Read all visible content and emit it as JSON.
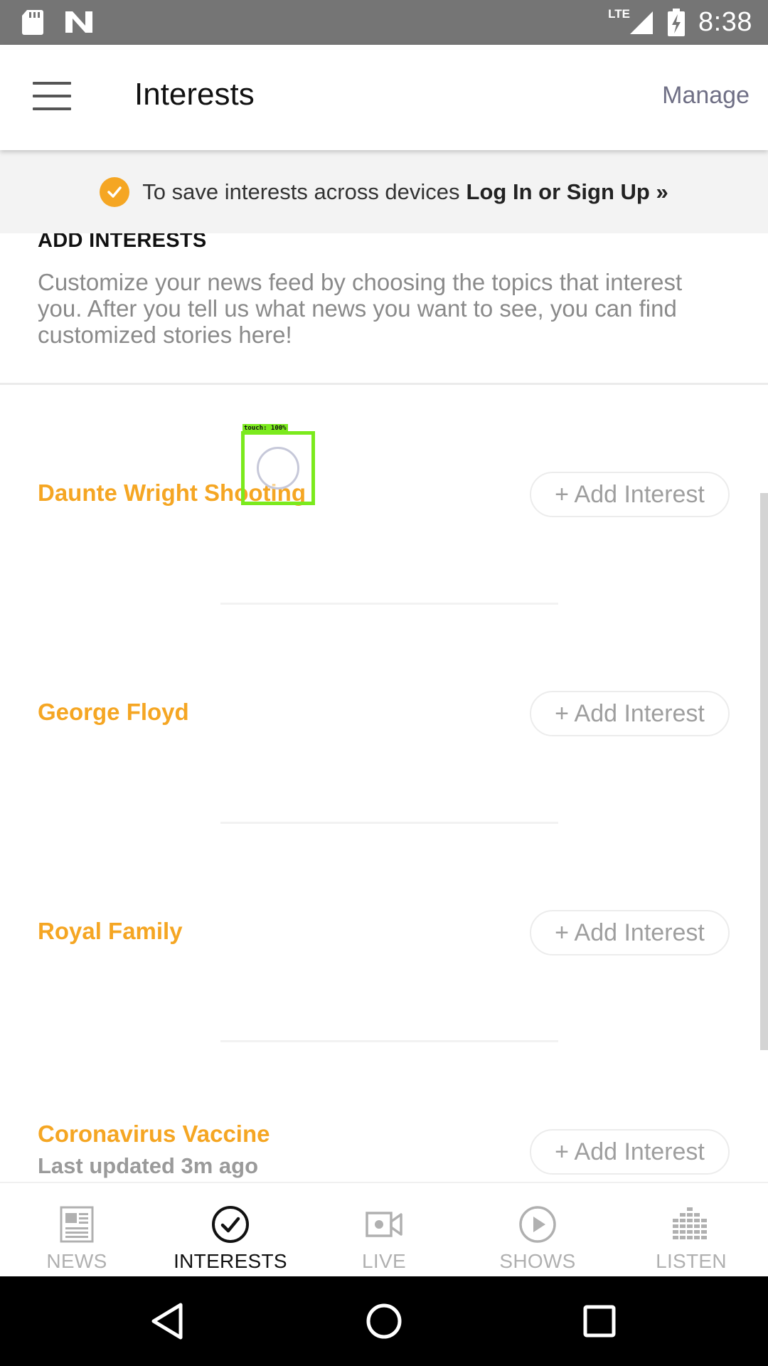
{
  "status_bar": {
    "time": "8:38",
    "network": "LTE",
    "icons": [
      "sd-card-icon",
      "n-notification-icon",
      "signal-icon",
      "battery-charging-icon"
    ]
  },
  "app_bar": {
    "title": "Interests",
    "manage_label": "Manage",
    "menu_icon": "menu-icon"
  },
  "banner": {
    "text": "To save interests across devices",
    "link": "Log In or Sign Up »",
    "accent": "#f5a623"
  },
  "add_interests": {
    "heading": "ADD INTERESTS",
    "description": "Customize your news feed by choosing the topics that interest you. After you tell us what news you want to see, you can find customized stories here!"
  },
  "topics": [
    {
      "label": "Daunte Wright Shooting",
      "button": "+ Add Interest"
    },
    {
      "label": "George Floyd",
      "button": "+ Add Interest"
    },
    {
      "label": "Royal Family",
      "button": "+ Add Interest"
    },
    {
      "label": "Coronavirus Vaccine",
      "subtitle": "Last updated 3m ago",
      "button": "+ Add Interest"
    }
  ],
  "touch_overlay": {
    "label": "touch: 100%"
  },
  "bottom_nav": {
    "items": [
      {
        "label": "NEWS",
        "icon": "newspaper-icon",
        "active": false
      },
      {
        "label": "INTERESTS",
        "icon": "check-circle-icon",
        "active": true
      },
      {
        "label": "LIVE",
        "icon": "video-camera-icon",
        "active": false
      },
      {
        "label": "SHOWS",
        "icon": "play-circle-icon",
        "active": false
      },
      {
        "label": "LISTEN",
        "icon": "equalizer-icon",
        "active": false
      }
    ]
  },
  "system_nav": {
    "icons": [
      "back-icon",
      "home-icon",
      "recents-icon"
    ]
  },
  "colors": {
    "accent": "#f5a623",
    "status_bar": "#757575",
    "manage": "#6f6f85"
  }
}
